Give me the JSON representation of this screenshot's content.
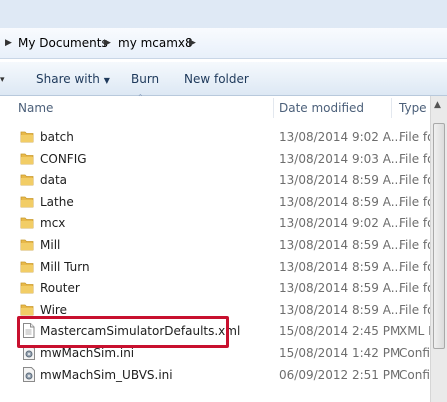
{
  "breadcrumb": {
    "items": [
      "My Documents",
      "my mcamx8"
    ]
  },
  "toolbar": {
    "share_with": "Share with",
    "burn": "Burn",
    "new_folder": "New folder"
  },
  "columns": {
    "name": "Name",
    "date_modified": "Date modified",
    "type": "Type"
  },
  "files": [
    {
      "name": "batch",
      "date": "13/08/2014 9:02 A...",
      "type": "File fo",
      "kind": "folder"
    },
    {
      "name": "CONFIG",
      "date": "13/08/2014 9:03 A...",
      "type": "File fo",
      "kind": "folder"
    },
    {
      "name": "data",
      "date": "13/08/2014 8:59 A...",
      "type": "File fo",
      "kind": "folder"
    },
    {
      "name": "Lathe",
      "date": "13/08/2014 8:59 A...",
      "type": "File fo",
      "kind": "folder"
    },
    {
      "name": "mcx",
      "date": "13/08/2014 9:02 A...",
      "type": "File fo",
      "kind": "folder"
    },
    {
      "name": "Mill",
      "date": "13/08/2014 8:59 A...",
      "type": "File fo",
      "kind": "folder"
    },
    {
      "name": "Mill Turn",
      "date": "13/08/2014 8:59 A...",
      "type": "File fo",
      "kind": "folder"
    },
    {
      "name": "Router",
      "date": "13/08/2014 8:59 A...",
      "type": "File fo",
      "kind": "folder"
    },
    {
      "name": "Wire",
      "date": "13/08/2014 8:59 A...",
      "type": "File fo",
      "kind": "folder"
    },
    {
      "name": "MastercamSimulatorDefaults.xml",
      "date": "15/08/2014 2:45 PM",
      "type": "XML D",
      "kind": "xml"
    },
    {
      "name": "mwMachSim.ini",
      "date": "15/08/2014 1:42 PM",
      "type": "Confi",
      "kind": "ini"
    },
    {
      "name": "mwMachSim_UBVS.ini",
      "date": "06/09/2012 2:51 PM",
      "type": "Confi",
      "kind": "ini"
    }
  ],
  "colors": {
    "highlight": "#c8102e",
    "folder": "#e8b94a",
    "toolbar_text": "#1e395b"
  }
}
